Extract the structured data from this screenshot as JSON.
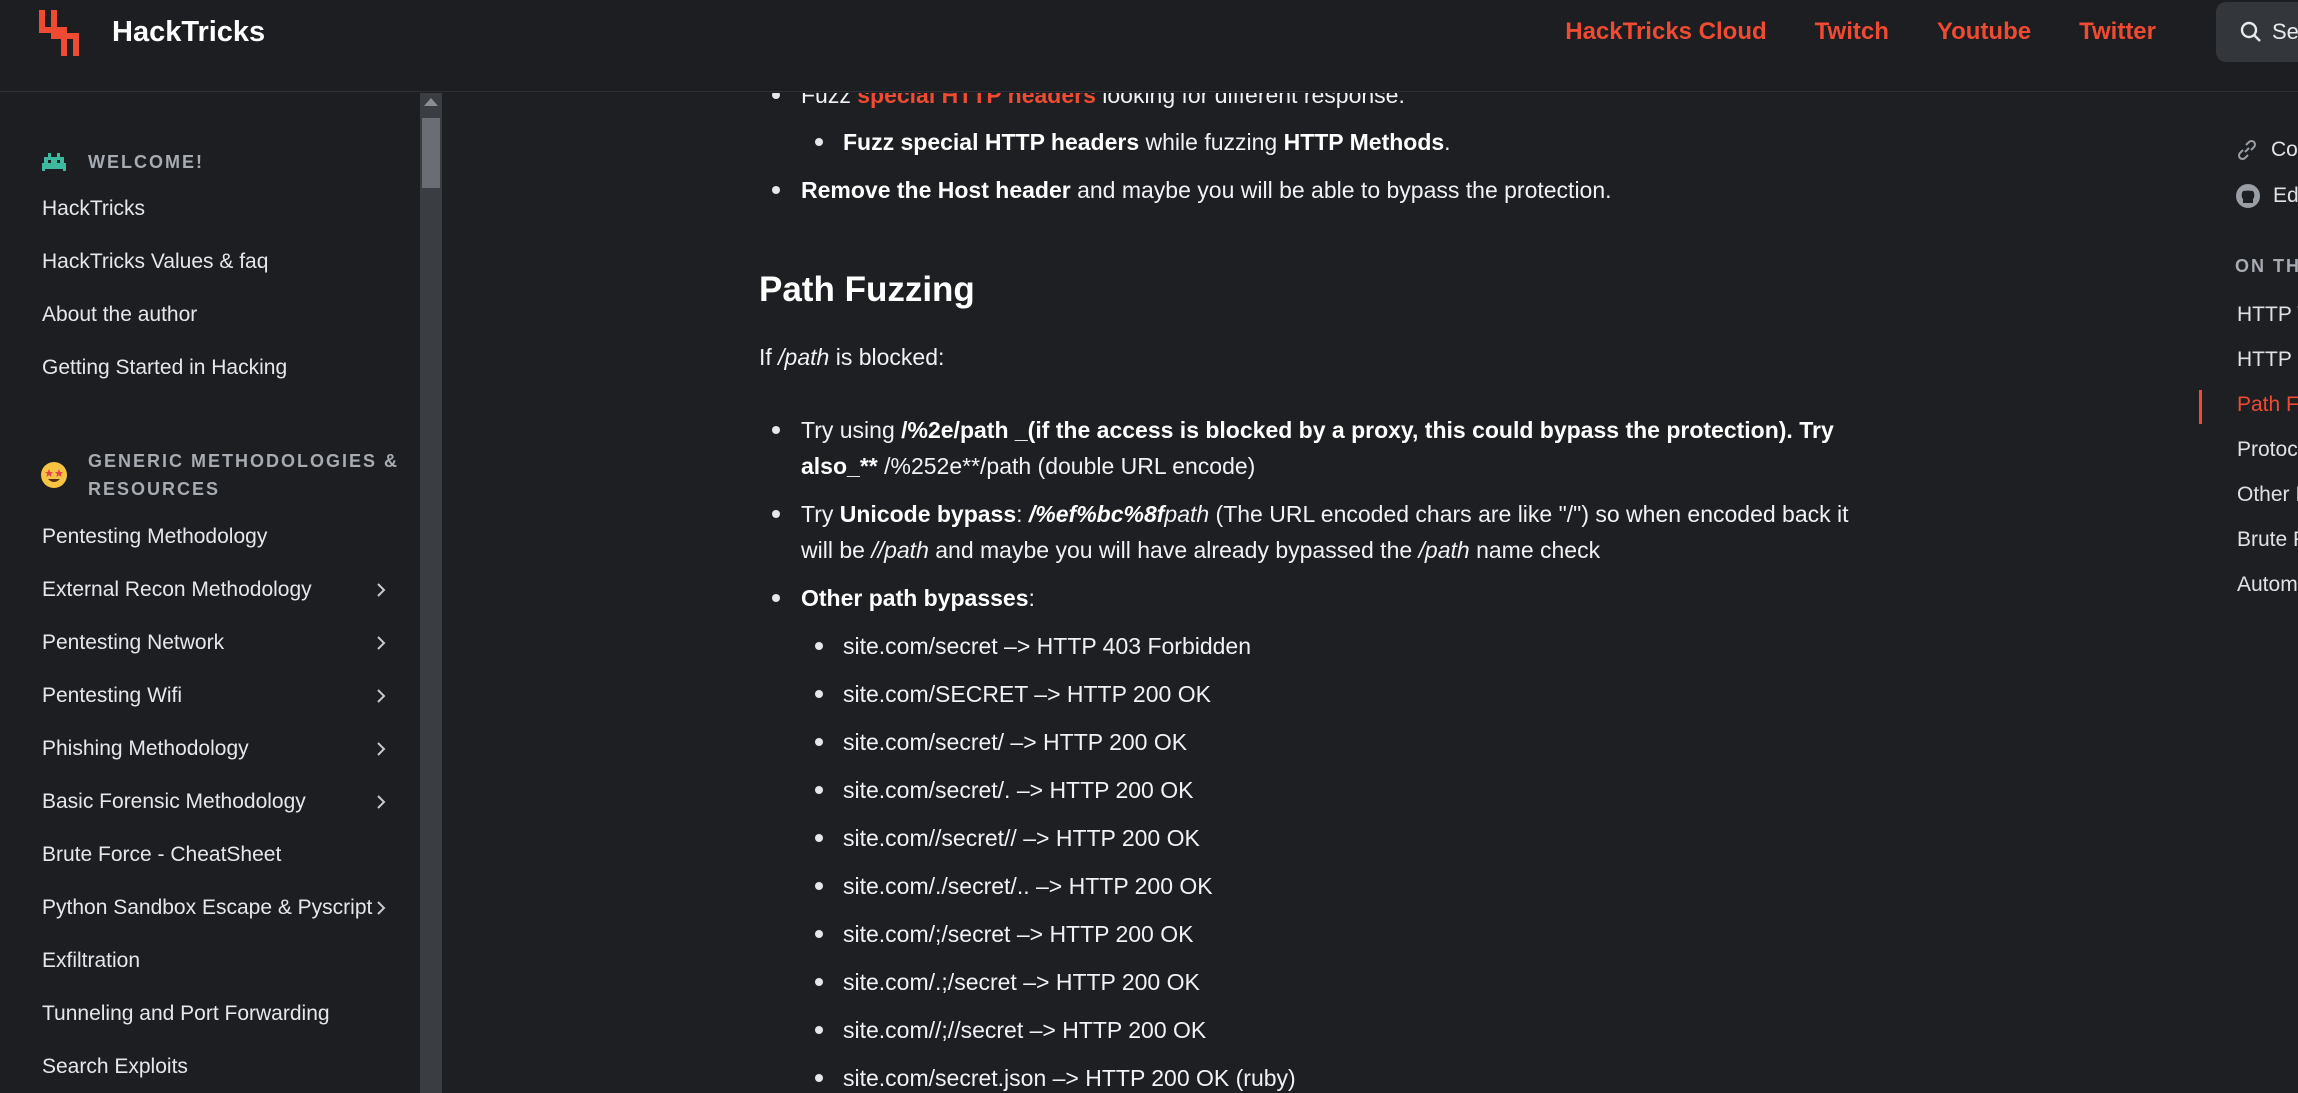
{
  "header": {
    "brand": "HackTricks",
    "links": [
      "HackTricks Cloud",
      "Twitch",
      "Youtube",
      "Twitter"
    ],
    "search_label": "Se"
  },
  "sidebar": {
    "section1": "WELCOME!",
    "section1_items": [
      "HackTricks",
      "HackTricks Values & faq",
      "About the author",
      "Getting Started in Hacking"
    ],
    "section2_line1": "GENERIC METHODOLOGIES &",
    "section2_line2": "RESOURCES",
    "section2_items": [
      {
        "label": "Pentesting Methodology",
        "expandable": false
      },
      {
        "label": "External Recon Methodology",
        "expandable": true
      },
      {
        "label": "Pentesting Network",
        "expandable": true
      },
      {
        "label": "Pentesting Wifi",
        "expandable": true
      },
      {
        "label": "Phishing Methodology",
        "expandable": true
      },
      {
        "label": "Basic Forensic Methodology",
        "expandable": true
      },
      {
        "label": "Brute Force - CheatSheet",
        "expandable": false
      },
      {
        "label": "Python Sandbox Escape & Pyscript",
        "expandable": true
      },
      {
        "label": "Exfiltration",
        "expandable": false
      },
      {
        "label": "Tunneling and Port Forwarding",
        "expandable": false
      },
      {
        "label": "Search Exploits",
        "expandable": false
      }
    ]
  },
  "main": {
    "top_bullet_a": "Fuzz ",
    "top_bullet_link": "special HTTP headers",
    "top_bullet_b": " looking for different response.",
    "sub_bullet_b1": "Fuzz special HTTP headers",
    "sub_bullet_t1": " while fuzzing ",
    "sub_bullet_b2": "HTTP Methods",
    "sub_bullet_t2": ".",
    "host_b": "Remove the Host header",
    "host_t": " and maybe you will be able to bypass the protection.",
    "heading": "Path Fuzzing",
    "intro_a": "If ",
    "intro_i": "/path",
    "intro_b": " is blocked:",
    "try1_a": "Try using ",
    "try1_b": "/%2e/path _(if the access is blocked by a proxy, this could bypass the protection). Try",
    "try1_c": "also_**",
    "try1_d": " /%252e**/path (double URL encode)",
    "try2_a": "Try ",
    "try2_b": "Unicode bypass",
    "try2_c": ": ",
    "try2_d": "/%ef%bc%8f",
    "try2_e": "path",
    "try2_f": " (The URL encoded chars are like \"/\") so when encoded back it",
    "try2_g": "will be ",
    "try2_h": "//path",
    "try2_i": " and maybe you will have already bypassed the ",
    "try2_j": "/path",
    "try2_k": " name check",
    "other_b": "Other path bypasses",
    "other_t": ":",
    "bypasses": [
      "site.com/secret –> HTTP 403 Forbidden",
      "site.com/SECRET –> HTTP 200 OK",
      "site.com/secret/ –> HTTP 200 OK",
      "site.com/secret/. –> HTTP 200 OK",
      "site.com//secret// –> HTTP 200 OK",
      "site.com/./secret/.. –> HTTP 200 OK",
      "site.com/;/secret –> HTTP 200 OK",
      "site.com/.;/secret –> HTTP 200 OK",
      "site.com//;//secret –> HTTP 200 OK",
      "site.com/secret.json –> HTTP 200 OK (ruby)"
    ]
  },
  "toc": {
    "copy": "Co",
    "edit": "Ed",
    "heading": "ON TH",
    "items": [
      "HTTP V",
      "HTTP I",
      "Path F",
      "Protoc",
      "Other I",
      "Brute F",
      "Autom"
    ]
  },
  "colors": {
    "accent": "#ef4b32",
    "background": "#1d1f22"
  }
}
